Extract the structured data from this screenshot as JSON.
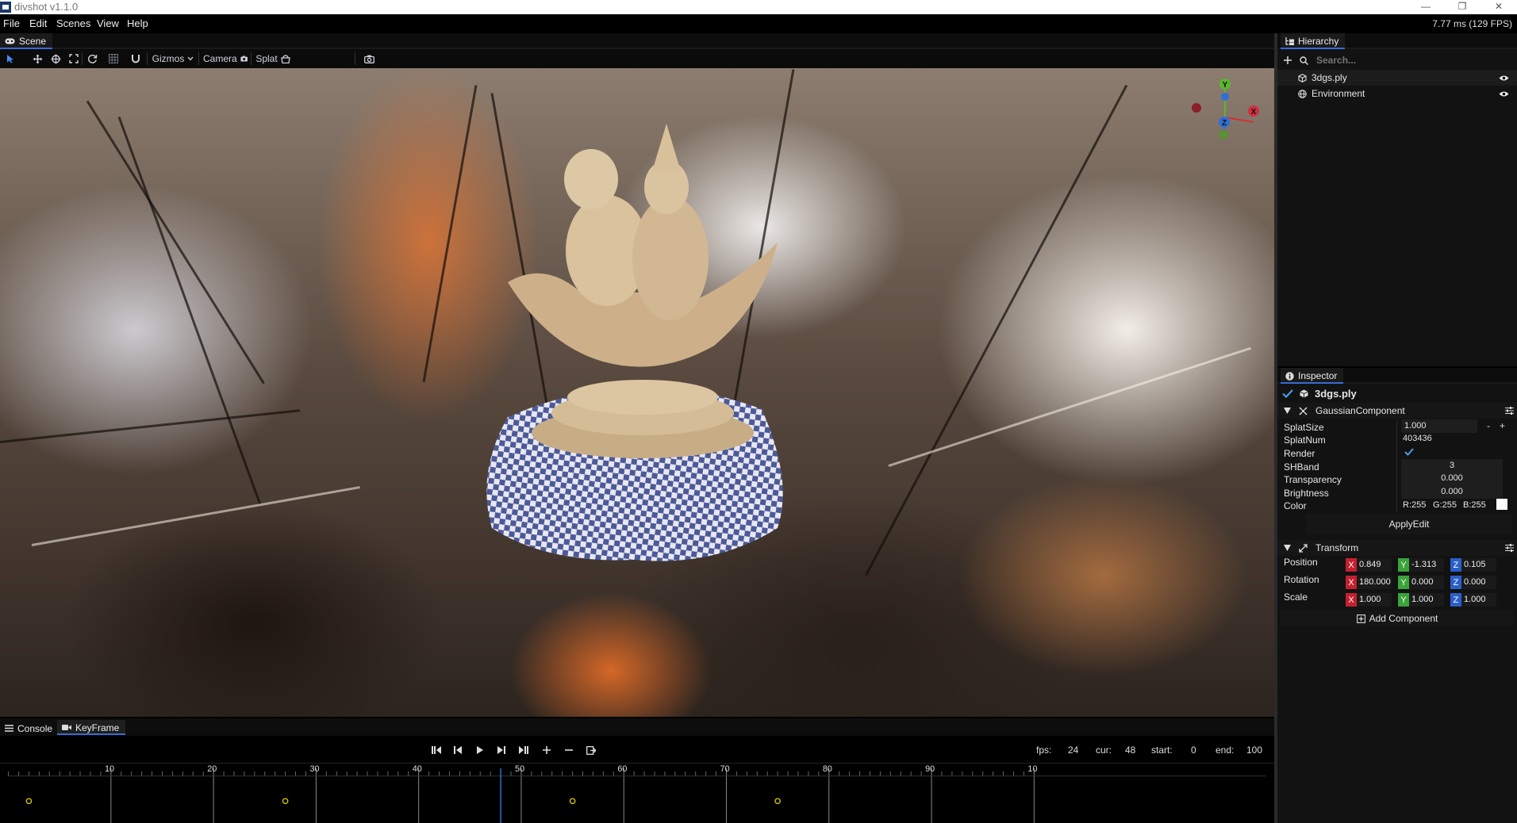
{
  "window": {
    "title": "divshot v1.1.0",
    "controls": [
      "—",
      "❐",
      "✕"
    ]
  },
  "menu": {
    "items": [
      "File",
      "Edit",
      "Scenes",
      "View",
      "Help"
    ],
    "perf": "7.77 ms (129 FPS)"
  },
  "scene": {
    "tab_label": "Scene",
    "toolbar": {
      "gizmos_label": "Gizmos",
      "camera_label": "Camera",
      "splat_label": "Splat"
    }
  },
  "gizmo": {
    "x_label": "X",
    "y_label": "Y",
    "z_label": "Z",
    "x_color": "#d12f3f",
    "y_color": "#5ab72f",
    "z_color": "#2e6fd6"
  },
  "hierarchy": {
    "tab_label": "Hierarchy",
    "search_placeholder": "Search...",
    "items": [
      {
        "label": "3dgs.ply",
        "icon": "cube-icon",
        "visible": true
      },
      {
        "label": "Environment",
        "icon": "globe-icon",
        "visible": true
      }
    ]
  },
  "inspector": {
    "tab_label": "Inspector",
    "object_name": "3dgs.ply",
    "enabled": true,
    "gaussian": {
      "title": "GaussianComponent",
      "splat_size_label": "SplatSize",
      "splat_size": "1.000",
      "minus": "-",
      "plus": "+",
      "splat_num_label": "SplatNum",
      "splat_num": "403436",
      "render_label": "Render",
      "render": true,
      "shband_label": "SHBand",
      "shband": "3",
      "transparency_label": "Transparency",
      "transparency": "0.000",
      "brightness_label": "Brightness",
      "brightness": "0.000",
      "color_label": "Color",
      "color_r": "R:255",
      "color_g": "G:255",
      "color_b": "B:255",
      "color_swatch": "#ffffff",
      "apply_label": "ApplyEdit"
    },
    "transform": {
      "title": "Transform",
      "position_label": "Position",
      "rotation_label": "Rotation",
      "scale_label": "Scale",
      "position": {
        "x": "0.849",
        "y": "-1.313",
        "z": "0.105"
      },
      "rotation": {
        "x": "180.000",
        "y": "0.000",
        "z": "0.000"
      },
      "scale": {
        "x": "1.000",
        "y": "1.000",
        "z": "1.000"
      }
    },
    "add_component_label": "Add Component"
  },
  "bottom": {
    "tabs": [
      {
        "label": "Console",
        "active": false
      },
      {
        "label": "KeyFrame",
        "active": true
      }
    ],
    "playback": {
      "fps_label": "fps:",
      "fps": "24",
      "cur_label": "cur:",
      "cur": "48",
      "start_label": "start:",
      "start": "0",
      "end_label": "end:",
      "end": "100"
    },
    "timeline": {
      "tick_labels": [
        "10",
        "20",
        "30",
        "40",
        "50",
        "60",
        "70",
        "80",
        "90",
        "10"
      ],
      "keyframes": [
        2,
        27,
        55,
        75
      ],
      "current_frame": 48
    }
  }
}
